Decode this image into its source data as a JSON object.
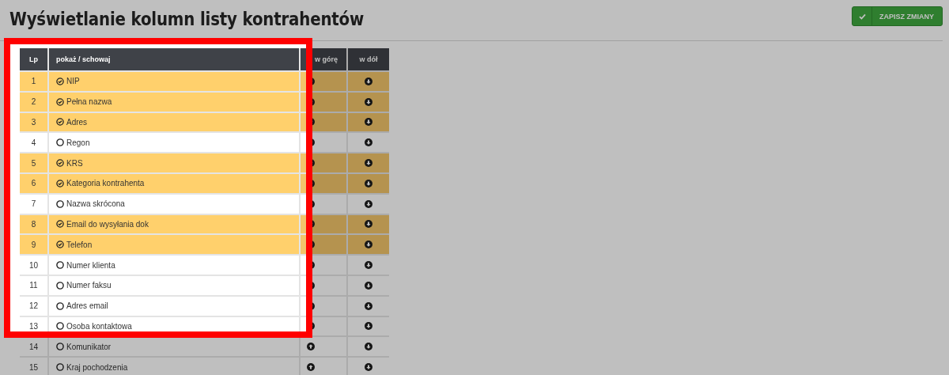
{
  "title": "Wyświetlanie kolumn listy kontrahentów",
  "save_button": {
    "label": "ZAPISZ ZMIANY"
  },
  "table": {
    "columns": [
      "Lp",
      "pokaż / schowaj",
      "w górę",
      "w dół"
    ],
    "rows": [
      {
        "lp": "1",
        "label": "NIP",
        "shown": true
      },
      {
        "lp": "2",
        "label": "Pełna nazwa",
        "shown": true
      },
      {
        "lp": "3",
        "label": "Adres",
        "shown": true
      },
      {
        "lp": "4",
        "label": "Regon",
        "shown": false
      },
      {
        "lp": "5",
        "label": "KRS",
        "shown": true
      },
      {
        "lp": "6",
        "label": "Kategoria kontrahenta",
        "shown": true
      },
      {
        "lp": "7",
        "label": "Nazwa skrócona",
        "shown": false
      },
      {
        "lp": "8",
        "label": "Email do wysyłania dok",
        "shown": true
      },
      {
        "lp": "9",
        "label": "Telefon",
        "shown": true
      },
      {
        "lp": "10",
        "label": "Numer klienta",
        "shown": false
      },
      {
        "lp": "11",
        "label": "Numer faksu",
        "shown": false
      },
      {
        "lp": "12",
        "label": "Adres email",
        "shown": false
      },
      {
        "lp": "13",
        "label": "Osoba kontaktowa",
        "shown": false
      },
      {
        "lp": "14",
        "label": "Komunikator",
        "shown": false
      },
      {
        "lp": "15",
        "label": "Kraj pochodzenia",
        "shown": false
      }
    ]
  }
}
